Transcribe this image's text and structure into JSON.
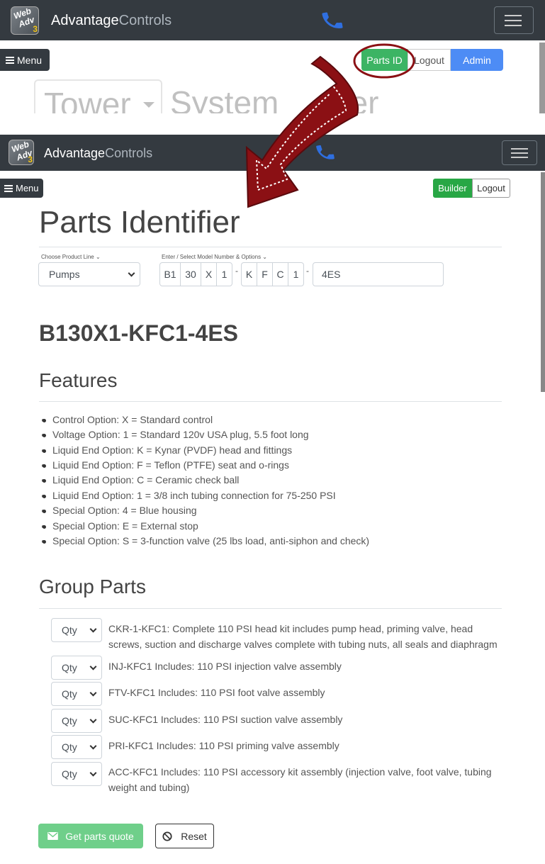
{
  "brand": {
    "name_bold": "Advantage",
    "name_light": "Controls",
    "logo_line1": "Web",
    "logo_line2": "Adv",
    "logo_badge": "3"
  },
  "menu_label": "Menu",
  "top_screenshot": {
    "parts_id_label": "Parts ID",
    "logout_label": "Logout",
    "admin_label": "Admin",
    "title_dropdown": "Tower",
    "title_word1": "System",
    "title_word2": "der"
  },
  "header": {
    "builder_label": "Builder",
    "logout_label": "Logout"
  },
  "page_title": "Parts Identifier",
  "form": {
    "product_line_label": "Choose Product Line",
    "product_line_value": "Pumps",
    "model_label": "Enter / Select Model Number & Options",
    "segments1": [
      "B1",
      "30",
      "X",
      "1"
    ],
    "segments2": [
      "K",
      "F",
      "C",
      "1"
    ],
    "separator": "-",
    "suffix": "4ES"
  },
  "model_number": "B130X1-KFC1-4ES",
  "features_heading": "Features",
  "features": [
    "Control Option: X = Standard control",
    "Voltage Option: 1 = Standard 120v USA plug, 5.5 foot long",
    "Liquid End Option: K = Kynar (PVDF) head and fittings",
    "Liquid End Option: F = Teflon (PTFE) seat and o-rings",
    "Liquid End Option: C = Ceramic check ball",
    "Liquid End Option: 1 = 3/8 inch tubing connection for 75-250 PSI",
    "Special Option: 4 = Blue housing",
    "Special Option: E = External stop",
    "Special Option: S = 3-function valve (25 lbs load, anti-siphon and check)"
  ],
  "group_parts_heading": "Group Parts",
  "qty_label": "Qty",
  "parts": [
    "CKR-1-KFC1: Complete 110 PSI head kit includes pump head, priming valve, head screws, suction and discharge valves complete with tubing nuts, all seals and diaphragm",
    "INJ-KFC1 Includes: 110 PSI injection valve assembly",
    "FTV-KFC1 Includes: 110 PSI foot valve assembly",
    "SUC-KFC1 Includes: 110 PSI suction valve assembly",
    "PRI-KFC1 Includes: 110 PSI priming valve assembly",
    "ACC-KFC1 Includes: 110 PSI accessory kit assembly (injection valve, foot valve, tubing weight and tubing)"
  ],
  "buttons": {
    "quote_label": "Get parts quote",
    "reset_label": "Reset"
  },
  "colors": {
    "navbar": "#343a40",
    "success": "#28a745",
    "primary": "#4d8cf5",
    "annotation": "#8b1014",
    "phone": "#2f6fe0"
  },
  "icons": [
    "hamburger-icon",
    "phone-icon",
    "envelope-icon",
    "ban-icon",
    "curved-arrow-annotation"
  ]
}
